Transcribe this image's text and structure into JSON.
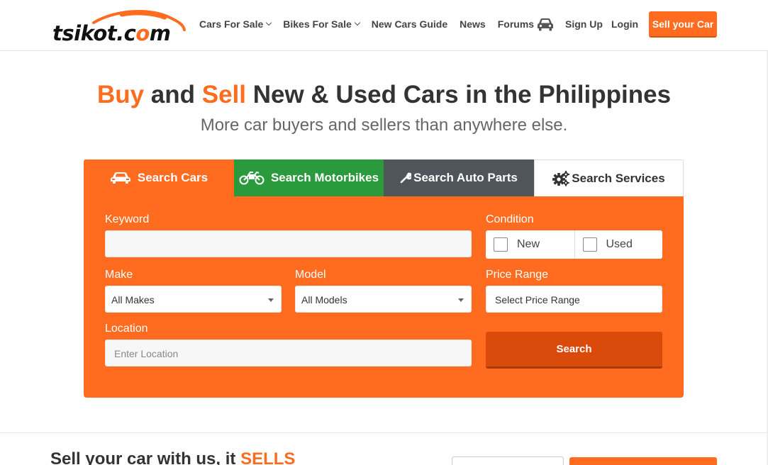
{
  "header": {
    "logo_text_pre": "tsikot.c",
    "logo_text_o": "o",
    "logo_text_post": "m",
    "nav": [
      {
        "label": "Cars For Sale",
        "dropdown": true
      },
      {
        "label": "Bikes For Sale",
        "dropdown": true
      },
      {
        "label": "New Cars Guide",
        "dropdown": false
      },
      {
        "label": "News",
        "dropdown": false
      },
      {
        "label": "Forums",
        "dropdown": false
      }
    ],
    "garage_icon": "car-icon",
    "signup": "Sign Up",
    "login": "Login",
    "sell_button": "Sell your Car"
  },
  "hero": {
    "title_buy": "Buy",
    "title_and": " and ",
    "title_sell": "Sell",
    "title_rest": " New & Used Cars in the Philippines",
    "subtitle": "More car buyers and sellers than anywhere else."
  },
  "tabs": [
    {
      "label": "Search Cars",
      "icon": "car-icon"
    },
    {
      "label": "Search Motorbikes",
      "icon": "motorbike-icon"
    },
    {
      "label": "Search Auto Parts",
      "icon": "wrench-icon"
    },
    {
      "label": "Search Services",
      "icon": "gears-icon"
    }
  ],
  "form": {
    "keyword_label": "Keyword",
    "keyword_value": "",
    "condition_label": "Condition",
    "condition_options": [
      "New",
      "Used"
    ],
    "make_label": "Make",
    "make_value": "All Makes",
    "model_label": "Model",
    "model_value": "All Models",
    "price_label": "Price Range",
    "price_value": "Select Price Range",
    "location_label": "Location",
    "location_placeholder": "Enter Location",
    "search_button": "Search"
  },
  "sell_section": {
    "heading_pre": "Sell your car with us, it ",
    "heading_accent": "SELLS"
  },
  "colors": {
    "brand_orange": "#ff6b1f",
    "motorbike_green": "#2b9a3d",
    "parts_gray": "#50555b",
    "search_button": "#d94a0b"
  }
}
